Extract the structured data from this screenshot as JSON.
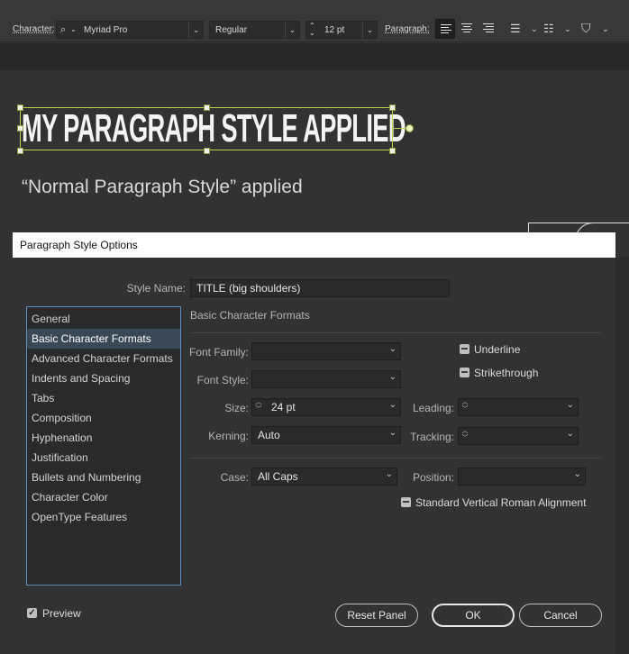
{
  "control_bar": {
    "character_label": "Character:",
    "font_family": "Myriad Pro",
    "font_style": "Regular",
    "font_size": "12 pt",
    "paragraph_label": "Paragraph:"
  },
  "artboard": {
    "styled_text": "MY PARAGRAPH STYLE APPLIED",
    "normal_text": "“Normal Paragraph Style” applied"
  },
  "dialog": {
    "title": "Paragraph Style Options",
    "style_name_label": "Style Name:",
    "style_name_value": "TITLE (big shoulders)",
    "categories": [
      "General",
      "Basic Character Formats",
      "Advanced Character Formats",
      "Indents and Spacing",
      "Tabs",
      "Composition",
      "Hyphenation",
      "Justification",
      "Bullets and Numbering",
      "Character Color",
      "OpenType Features"
    ],
    "selected_category": "Basic Character Formats",
    "section_title": "Basic Character Formats",
    "font_family_label": "Font Family:",
    "font_family_value": "",
    "font_style_label": "Font Style:",
    "font_style_value": "",
    "size_label": "Size:",
    "size_value": "24 pt",
    "leading_label": "Leading:",
    "leading_value": "",
    "kerning_label": "Kerning:",
    "kerning_value": "Auto",
    "tracking_label": "Tracking:",
    "tracking_value": "",
    "underline_label": "Underline",
    "strikethrough_label": "Strikethrough",
    "case_label": "Case:",
    "case_value": "All Caps",
    "position_label": "Position:",
    "position_value": "",
    "standard_vertical_label": "Standard Vertical Roman Alignment",
    "preview_label": "Preview",
    "preview_checked": true,
    "reset_button": "Reset Panel",
    "ok_button": "OK",
    "cancel_button": "Cancel"
  }
}
